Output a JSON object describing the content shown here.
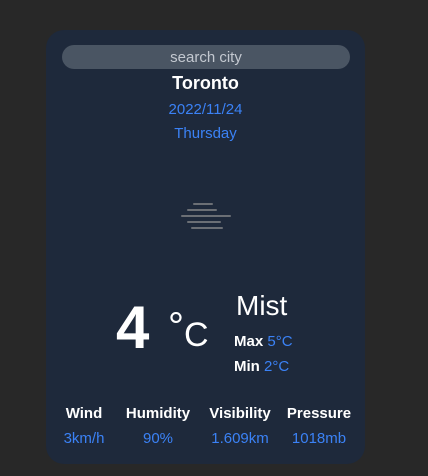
{
  "search": {
    "placeholder": "search city",
    "value": ""
  },
  "location": {
    "city": "Toronto",
    "date": "2022/11/24",
    "day": "Thursday"
  },
  "weather": {
    "icon": "mist-icon",
    "temperature": "4",
    "degree_symbol": "°",
    "unit": "C",
    "condition": "Mist",
    "max_label": "Max",
    "max_value": "5°C",
    "min_label": "Min",
    "min_value": "2°C"
  },
  "stats": [
    {
      "label": "Wind",
      "value": "3km/h"
    },
    {
      "label": "Humidity",
      "value": "90%"
    },
    {
      "label": "Visibility",
      "value": "1.609km"
    },
    {
      "label": "Pressure",
      "value": "1018mb"
    }
  ],
  "colors": {
    "page_background": "#282828",
    "card_background": "#1e293b",
    "accent": "#3b82f6",
    "search_background": "#4a5563"
  }
}
